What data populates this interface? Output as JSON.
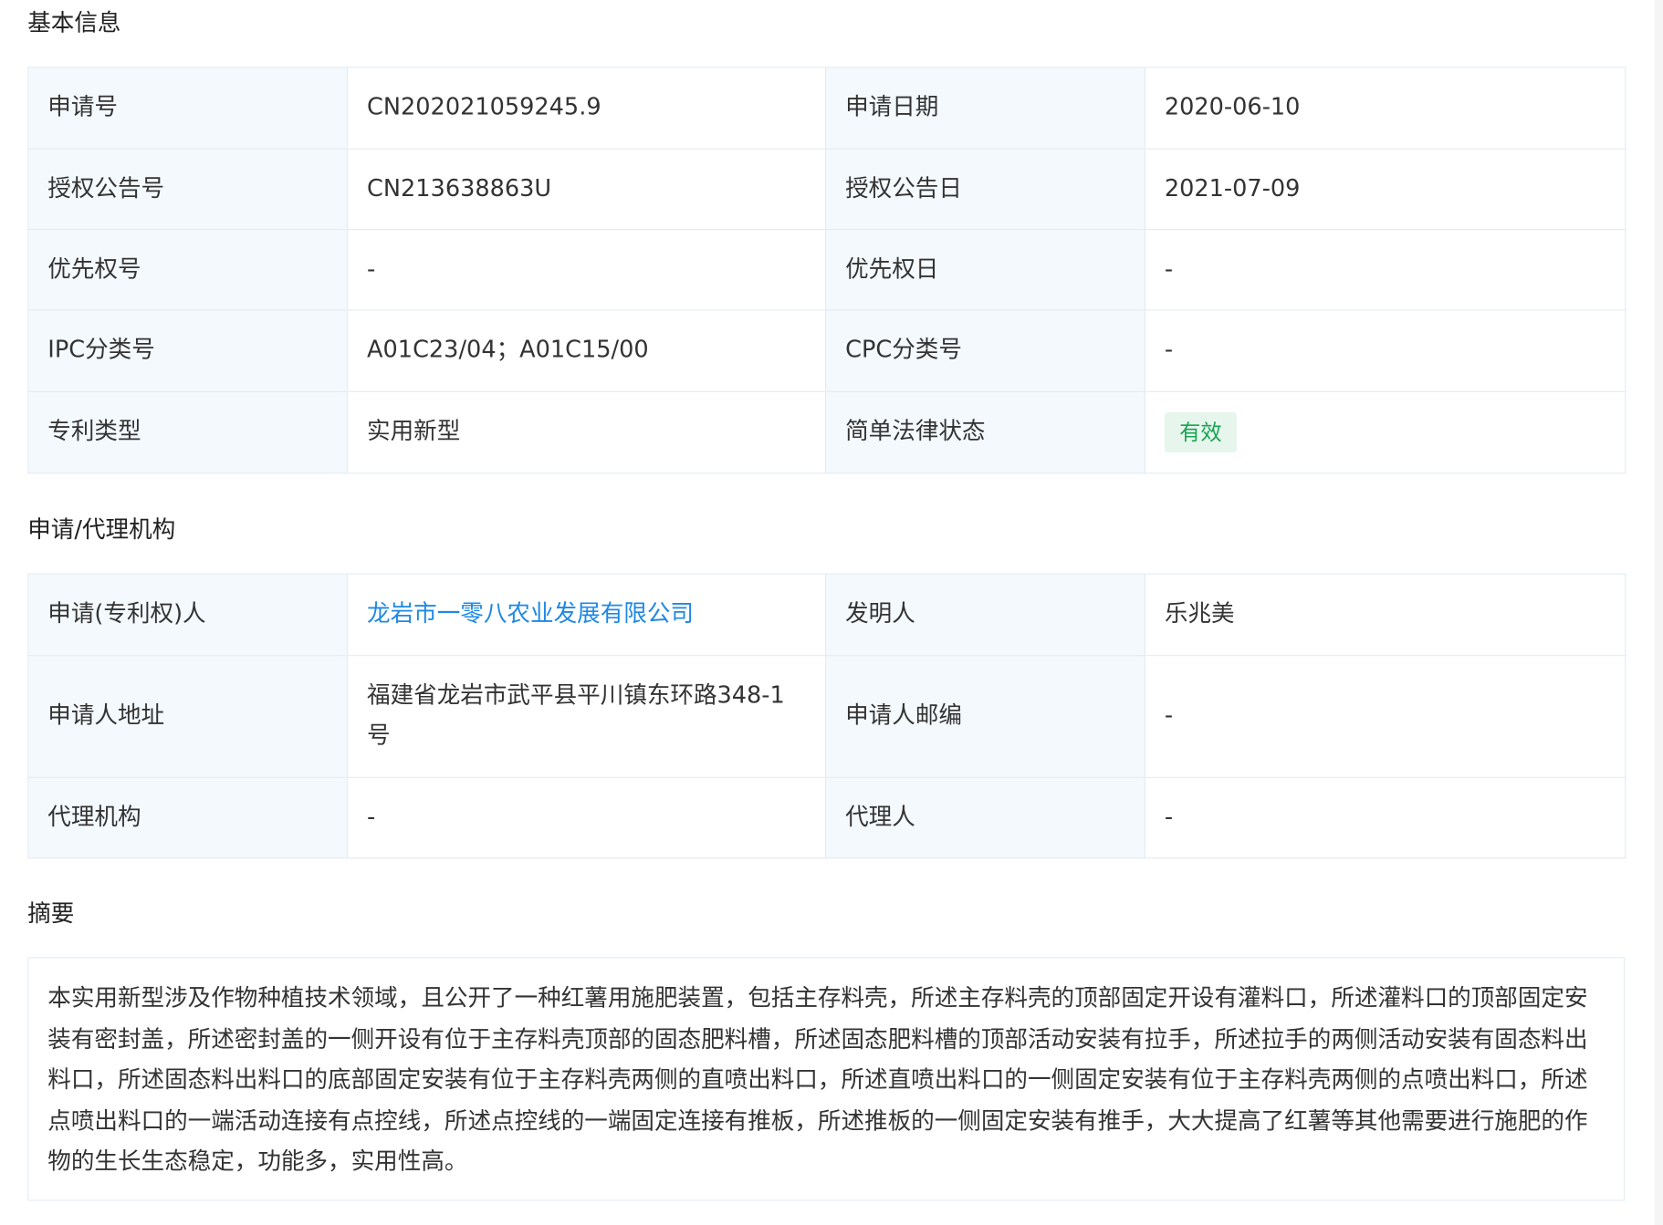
{
  "basic_info": {
    "title": "基本信息",
    "rows": [
      {
        "l1": "申请号",
        "v1": "CN202021059245.9",
        "l2": "申请日期",
        "v2": "2020-06-10"
      },
      {
        "l1": "授权公告号",
        "v1": "CN213638863U",
        "l2": "授权公告日",
        "v2": "2021-07-09"
      },
      {
        "l1": "优先权号",
        "v1": "-",
        "l2": "优先权日",
        "v2": "-"
      },
      {
        "l1": "IPC分类号",
        "v1": "A01C23/04；A01C15/00",
        "l2": "CPC分类号",
        "v2": "-"
      },
      {
        "l1": "专利类型",
        "v1": "实用新型",
        "l2": "简单法律状态",
        "v2": "有效"
      }
    ],
    "status_color": "#19a352"
  },
  "applicant": {
    "title": "申请/代理机构",
    "rows": [
      {
        "l1": "申请(专利权)人",
        "v1": "龙岩市一零八农业发展有限公司",
        "l2": "发明人",
        "v2": "乐兆美"
      },
      {
        "l1": "申请人地址",
        "v1": "福建省龙岩市武平县平川镇东环路348-1号",
        "l2": "申请人邮编",
        "v2": "-"
      },
      {
        "l1": "代理机构",
        "v1": "-",
        "l2": "代理人",
        "v2": "-"
      }
    ],
    "link_color": "#1e88e5"
  },
  "abstract": {
    "title": "摘要",
    "text": "本实用新型涉及作物种植技术领域，且公开了一种红薯用施肥装置，包括主存料壳，所述主存料壳的顶部固定开设有灌料口，所述灌料口的顶部固定安装有密封盖，所述密封盖的一侧开设有位于主存料壳顶部的固态肥料槽，所述固态肥料槽的顶部活动安装有拉手，所述拉手的两侧活动安装有固态料出料口，所述固态料出料口的底部固定安装有位于主存料壳两侧的直喷出料口，所述直喷出料口的一侧固定安装有位于主存料壳两侧的点喷出料口，所述点喷出料口的一端活动连接有点控线，所述点控线的一端固定连接有推板，所述推板的一侧固定安装有推手，大大提高了红薯等其他需要进行施肥的作物的生长生态稳定，功能多，实用性高。"
  }
}
